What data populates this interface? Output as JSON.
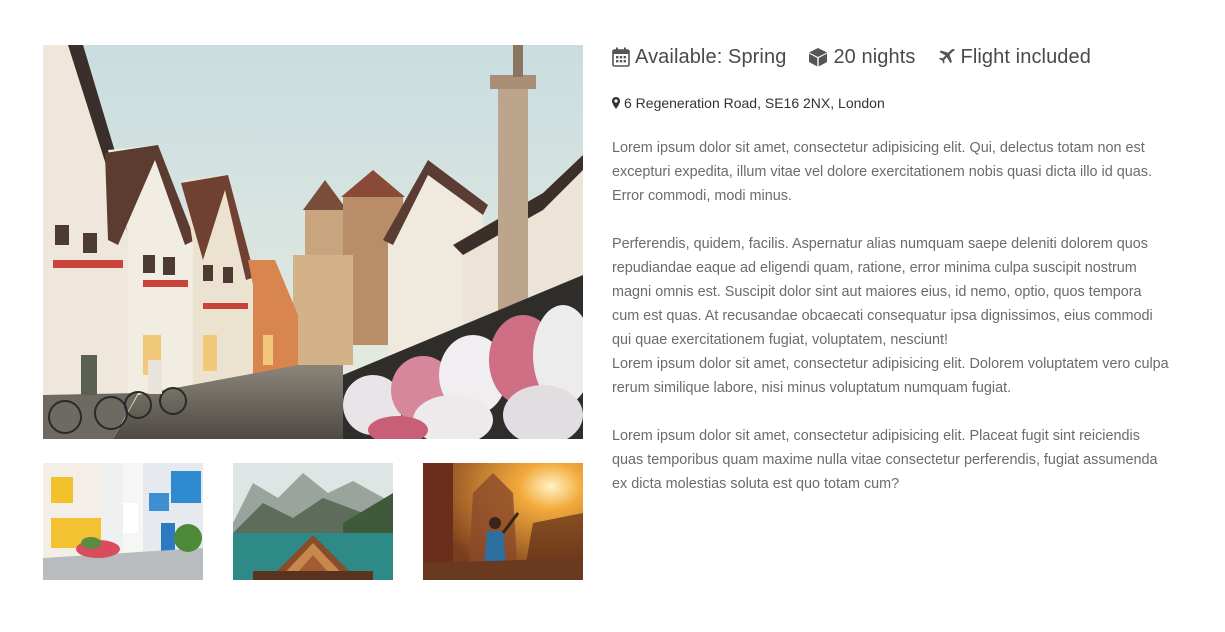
{
  "meta": {
    "availability": "Available: Spring",
    "duration": "20 nights",
    "flight": "Flight included"
  },
  "icons": {
    "availability": "calendar-icon",
    "duration": "cube-icon",
    "flight": "plane-icon",
    "address": "map-marker-icon"
  },
  "address": "6 Regeneration Road, SE16 2NX, London",
  "paragraphs": {
    "p1": "Lorem ipsum dolor sit amet, consectetur adipisicing elit. Qui, delectus totam non est excepturi expedita, illum vitae vel dolore exercitationem nobis quasi dicta illo id quas. Error commodi, modi minus.",
    "p2": "Perferendis, quidem, facilis. Aspernatur alias numquam saepe deleniti dolorem quos repudiandae eaque ad eligendi quam, ratione, error minima culpa suscipit nostrum magni omnis est. Suscipit dolor sint aut maiores eius, id nemo, optio, quos tempora cum est quas. At recusandae obcaecati consequatur ipsa dignissimos, eius commodi qui quae exercitationem fugiat, voluptatem, nesciunt!",
    "p3": "Lorem ipsum dolor sit amet, consectetur adipisicing elit. Dolorem voluptatem vero culpa rerum similique labore, nisi minus voluptatum numquam fugiat.",
    "p4": "Lorem ipsum dolor sit amet, consectetur adipisicing elit. Placeat fugit sint reiciendis quas temporibus quam maxime nulla vitae consectetur perferendis, fugiat assumenda ex dicta molestias soluta est quo totam cum?"
  },
  "colors": {
    "text": "#4a4a4a",
    "body_text": "#6b6b6b"
  }
}
